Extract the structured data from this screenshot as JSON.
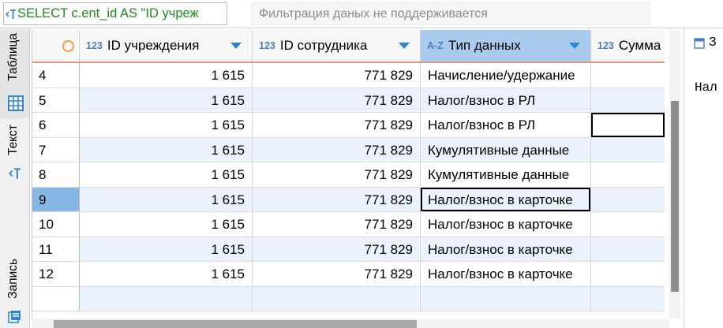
{
  "toolbar": {
    "query_text": "SELECT c.ent_id AS \"ID учреж",
    "filter_placeholder": "Фильтрация даных не поддерживается"
  },
  "side_tabs": {
    "table": "Таблица",
    "text": "Текст",
    "record": "Запись"
  },
  "grid": {
    "columns": [
      {
        "type": "123",
        "label": "ID учреждения"
      },
      {
        "type": "123",
        "label": "ID сотрудника"
      },
      {
        "type": "A-Z",
        "label": "Тип данных"
      },
      {
        "type": "123",
        "label": "Сумма"
      }
    ],
    "rows": [
      {
        "num": "4",
        "cells": [
          "1 615",
          "771 829",
          "Начисление/удержание"
        ]
      },
      {
        "num": "5",
        "cells": [
          "1 615",
          "771 829",
          "Налог/взнос в РЛ"
        ]
      },
      {
        "num": "6",
        "cells": [
          "1 615",
          "771 829",
          "Налог/взнос в РЛ"
        ],
        "outlined": 3
      },
      {
        "num": "7",
        "cells": [
          "1 615",
          "771 829",
          "Кумулятивные данные"
        ]
      },
      {
        "num": "8",
        "cells": [
          "1 615",
          "771 829",
          "Кумулятивные данные"
        ]
      },
      {
        "num": "9",
        "cells": [
          "1 615",
          "771 829",
          "Налог/взнос в карточке"
        ],
        "selected": true,
        "outlined": 2
      },
      {
        "num": "10",
        "cells": [
          "1 615",
          "771 829",
          "Налог/взнос в карточке"
        ]
      },
      {
        "num": "11",
        "cells": [
          "1 615",
          "771 829",
          "Налог/взнос в карточке"
        ]
      },
      {
        "num": "12",
        "cells": [
          "1 615",
          "771 829",
          "Налог/взнос в карточке"
        ]
      }
    ]
  },
  "value_panel": {
    "title": "З",
    "value": "Нал"
  },
  "colors": {
    "query": "#1d8a1d",
    "accent": "#2e86d3",
    "badge": "#4a7fc1",
    "selhead": "#a9cbee",
    "alt": "#eaf3fd",
    "selrow": "#86b6e4",
    "underline": "#e6957a",
    "circle": "#f0a030"
  },
  "icons": {
    "query": "text-mode-icon",
    "table_tab": "grid-icon",
    "text_tab": "text-mode-icon",
    "record_tab": "record-icon",
    "row_header": "circle-icon",
    "column_menu": "triangle-down-icon",
    "panel": "window-icon"
  }
}
